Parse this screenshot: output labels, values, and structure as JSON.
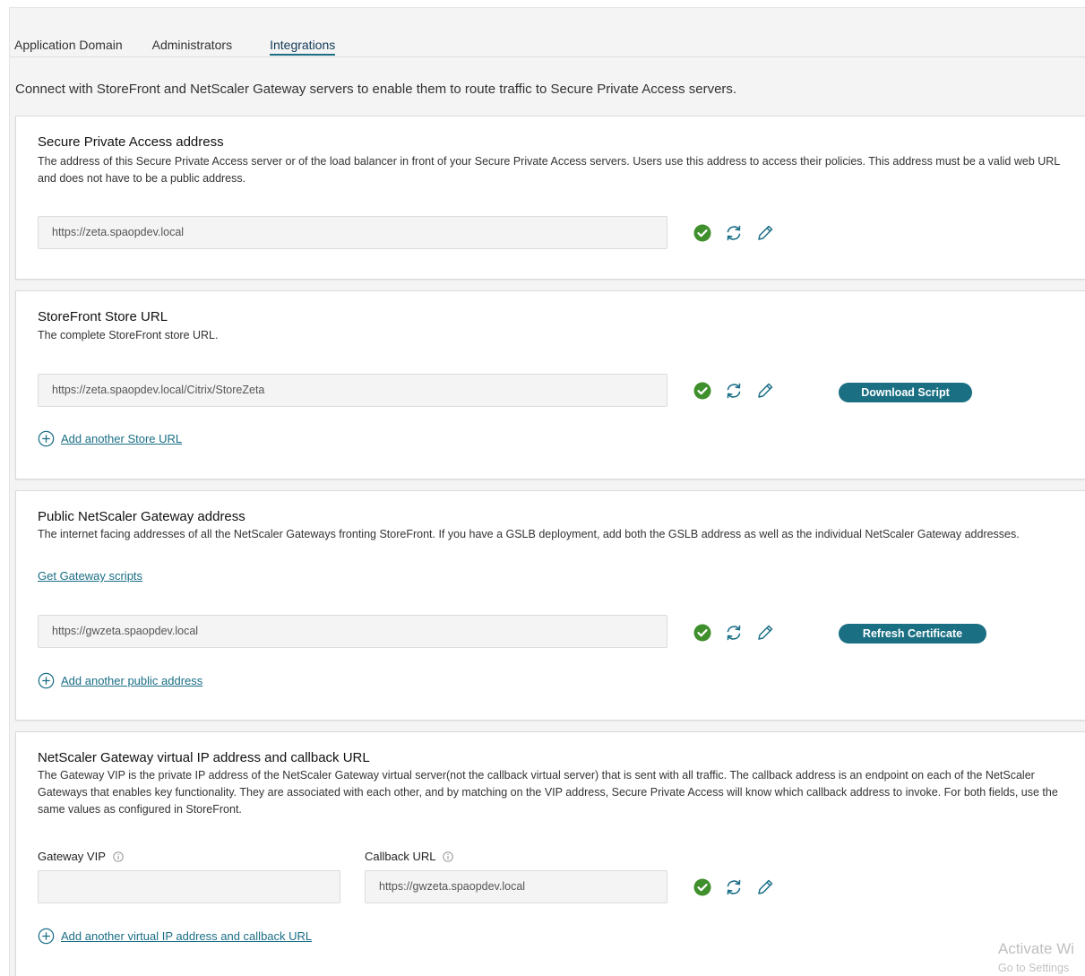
{
  "tabs": [
    {
      "label": "Application Domain",
      "active": false
    },
    {
      "label": "Administrators",
      "active": false
    },
    {
      "label": "Integrations",
      "active": true
    }
  ],
  "intro": "Connect with StoreFront and NetScaler Gateway servers to enable them to route traffic to Secure Private Access servers.",
  "spa_address": {
    "title": "Secure Private Access address",
    "description": "The address of this Secure Private Access server or of the load balancer in front of your Secure Private Access servers. Users use this address to access their policies. This address must be a valid web URL and does not have to be a public address.",
    "value": "https://zeta.spaopdev.local"
  },
  "storefront": {
    "title": "StoreFront Store URL",
    "description": "The complete StoreFront store URL.",
    "value": "https://zeta.spaopdev.local/Citrix/StoreZeta",
    "download_label": "Download Script",
    "add_label": "Add another Store URL"
  },
  "gateway": {
    "title": "Public NetScaler Gateway address",
    "description": "The internet facing addresses of all the NetScaler Gateways fronting StoreFront. If you have a GSLB deployment, add both the GSLB address as well as the individual NetScaler Gateway addresses.",
    "scripts_link": "Get Gateway scripts",
    "value": "https://gwzeta.spaopdev.local",
    "refresh_label": "Refresh Certificate",
    "add_label": "Add another public address"
  },
  "vip": {
    "title": "NetScaler Gateway virtual IP address and callback URL",
    "description": "The Gateway VIP is the private IP address of the NetScaler Gateway virtual server(not the callback virtual server) that is sent with all traffic. The callback address is an endpoint on each of the NetScaler Gateways that enables key functionality. They are associated with each other, and by matching on the VIP address, Secure Private Access will know which callback address to invoke. For both fields, use the same values as configured in StoreFront.",
    "vip_label": "Gateway VIP",
    "vip_value": "",
    "callback_label": "Callback URL",
    "callback_value": "https://gwzeta.spaopdev.local",
    "add_label": "Add another virtual IP address and callback URL"
  },
  "watermark": {
    "line1": "Activate Wi",
    "line2": "Go to Settings"
  },
  "colors": {
    "accent": "#1b6f83",
    "success": "#3f8f2c",
    "icon": "#1a6e86"
  }
}
